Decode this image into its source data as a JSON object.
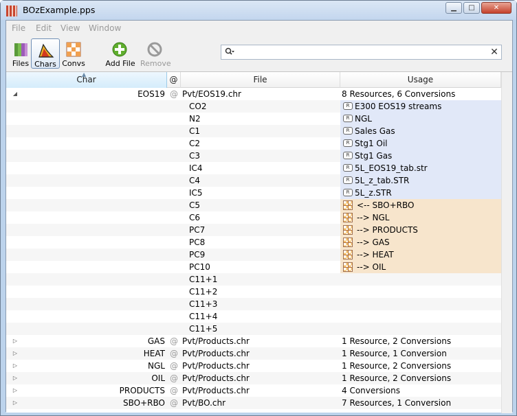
{
  "window": {
    "title": "BOzExample.pps"
  },
  "menu": [
    "File",
    "Edit",
    "View",
    "Window"
  ],
  "toolbar": {
    "files": "Files",
    "chars": "Chars",
    "convs": "Convs",
    "add_file": "Add File",
    "remove": "Remove"
  },
  "search": {
    "value": "",
    "placeholder": ""
  },
  "columns": {
    "char": "Char",
    "at": "@",
    "file": "File",
    "usage": "Usage"
  },
  "rows": [
    {
      "kind": "group",
      "expanded": true,
      "char": "EOS19",
      "at": "@",
      "file": "Pvt/EOS19.chr",
      "usage": "8 Resources, 6 Conversions"
    },
    {
      "kind": "res",
      "char": "CO2",
      "badge": "R",
      "usage": "E300 EOS19 streams"
    },
    {
      "kind": "res",
      "char": "N2",
      "badge": "R",
      "usage": "NGL"
    },
    {
      "kind": "res",
      "char": "C1",
      "badge": "R",
      "usage": "Sales Gas"
    },
    {
      "kind": "res",
      "char": "C2",
      "badge": "R",
      "usage": "Stg1 Oil"
    },
    {
      "kind": "res",
      "char": "C3",
      "badge": "R",
      "usage": "Stg1 Gas"
    },
    {
      "kind": "res",
      "char": "IC4",
      "badge": "R",
      "usage": "5L_EOS19_tab.str"
    },
    {
      "kind": "res",
      "char": "C4",
      "badge": "R",
      "usage": "5L_z_tab.STR"
    },
    {
      "kind": "res",
      "char": "IC5",
      "badge": "R",
      "usage": "5L_z.STR"
    },
    {
      "kind": "conv",
      "char": "C5",
      "usage": "<-- SBO+RBO"
    },
    {
      "kind": "conv",
      "char": "C6",
      "usage": "--> NGL"
    },
    {
      "kind": "conv",
      "char": "PC7",
      "usage": "--> PRODUCTS"
    },
    {
      "kind": "conv",
      "char": "PC8",
      "usage": "--> GAS"
    },
    {
      "kind": "conv",
      "char": "PC9",
      "usage": "--> HEAT"
    },
    {
      "kind": "conv",
      "char": "PC10",
      "usage": "--> OIL"
    },
    {
      "kind": "comp",
      "char": "C11+1",
      "usage": ""
    },
    {
      "kind": "comp",
      "char": "C11+2",
      "usage": ""
    },
    {
      "kind": "comp",
      "char": "C11+3",
      "usage": ""
    },
    {
      "kind": "comp",
      "char": "C11+4",
      "usage": ""
    },
    {
      "kind": "comp",
      "char": "C11+5",
      "usage": ""
    },
    {
      "kind": "group",
      "expanded": false,
      "char": "GAS",
      "at": "@",
      "file": "Pvt/Products.chr",
      "usage": "1 Resource, 2 Conversions"
    },
    {
      "kind": "group",
      "expanded": false,
      "char": "HEAT",
      "at": "@",
      "file": "Pvt/Products.chr",
      "usage": "1 Resource, 1 Conversion"
    },
    {
      "kind": "group",
      "expanded": false,
      "char": "NGL",
      "at": "@",
      "file": "Pvt/Products.chr",
      "usage": "1 Resource, 2 Conversions"
    },
    {
      "kind": "group",
      "expanded": false,
      "char": "OIL",
      "at": "@",
      "file": "Pvt/Products.chr",
      "usage": "1 Resource, 2 Conversions"
    },
    {
      "kind": "group",
      "expanded": false,
      "char": "PRODUCTS",
      "at": "@",
      "file": "Pvt/Products.chr",
      "usage": "4 Conversions"
    },
    {
      "kind": "group",
      "expanded": false,
      "char": "SBO+RBO",
      "at": "@",
      "file": "Pvt/BO.chr",
      "usage": "7 Resources, 1 Conversion"
    }
  ]
}
